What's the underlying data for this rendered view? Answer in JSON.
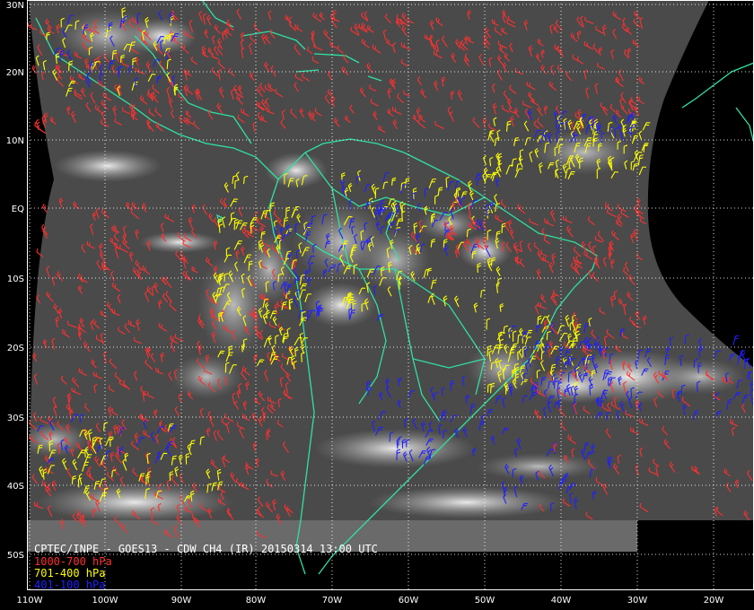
{
  "title": "CPTEC/INPE - GOES13 - CDW CH4 (IR) 20150314 13:00 UTC",
  "legend": [
    {
      "label": "1000-700 hPa",
      "color": "#ff3030"
    },
    {
      "label": "701-400 hPa",
      "color": "#ffff00"
    },
    {
      "label": "401-100 hPa",
      "color": "#2020ff"
    }
  ],
  "lat_labels": [
    "30N",
    "20N",
    "10N",
    "EQ",
    "10S",
    "20S",
    "30S",
    "40S",
    "50S"
  ],
  "lon_labels": [
    "110W",
    "100W",
    "90W",
    "80W",
    "70W",
    "60W",
    "50W",
    "40W",
    "30W",
    "20W"
  ],
  "colors": {
    "background": "#000000",
    "land_lines": "#30e0a0",
    "grid": "#ffffff",
    "label_text": "#ffffff"
  }
}
